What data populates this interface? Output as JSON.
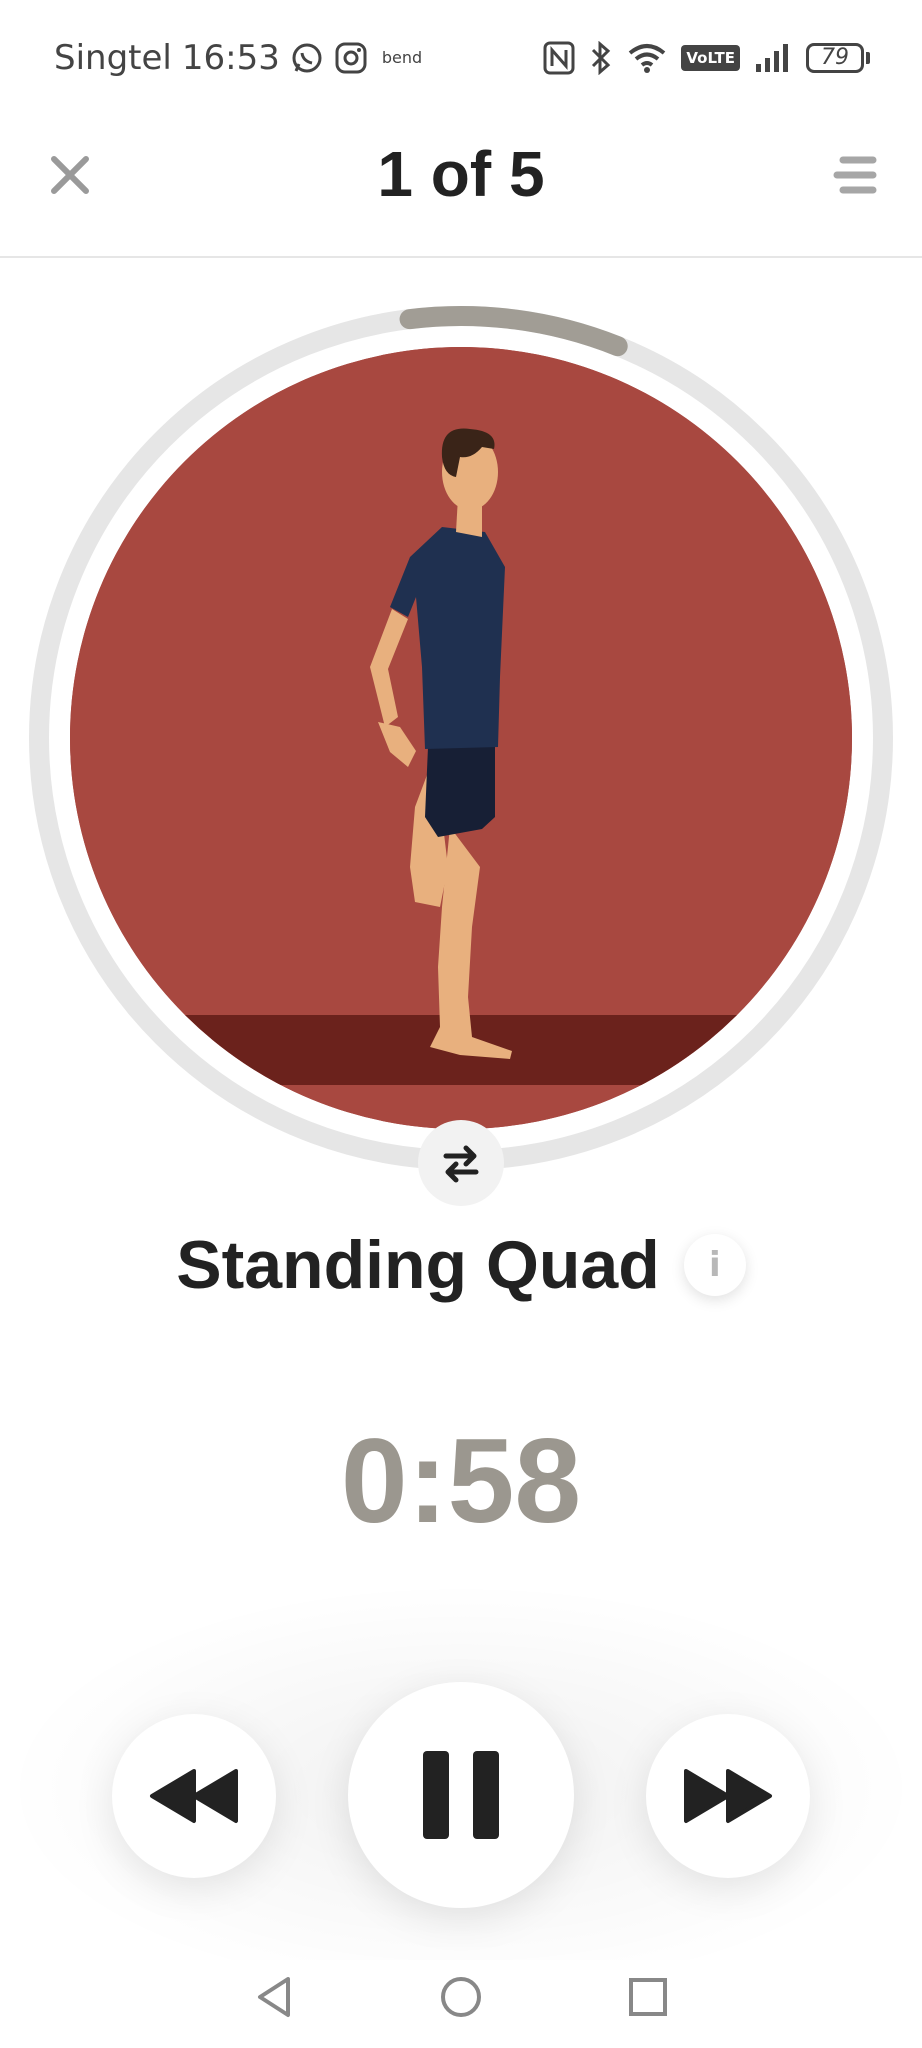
{
  "status_bar": {
    "carrier": "Singtel",
    "time": "16:53",
    "small_app_label": "bend",
    "volte": "VoLTE",
    "battery": "79"
  },
  "header": {
    "title": "1 of 5"
  },
  "exercise": {
    "name": "Standing Quad",
    "timer": "0:58",
    "progress": 0.08
  },
  "colors": {
    "illustration_bg": "#a84840",
    "floor": "#6b221c",
    "timer": "#9b978f",
    "ring": "#e6e6e6",
    "progress_arc": "#a19d95"
  },
  "icons": {
    "close": "close-icon",
    "menu": "menu-icon",
    "swap": "swap-sides-icon",
    "info": "info-icon",
    "rewind": "rewind-icon",
    "pause": "pause-icon",
    "forward": "fast-forward-icon",
    "back": "nav-back-icon",
    "home": "nav-home-icon",
    "recents": "nav-recents-icon"
  },
  "info_glyph": "i"
}
